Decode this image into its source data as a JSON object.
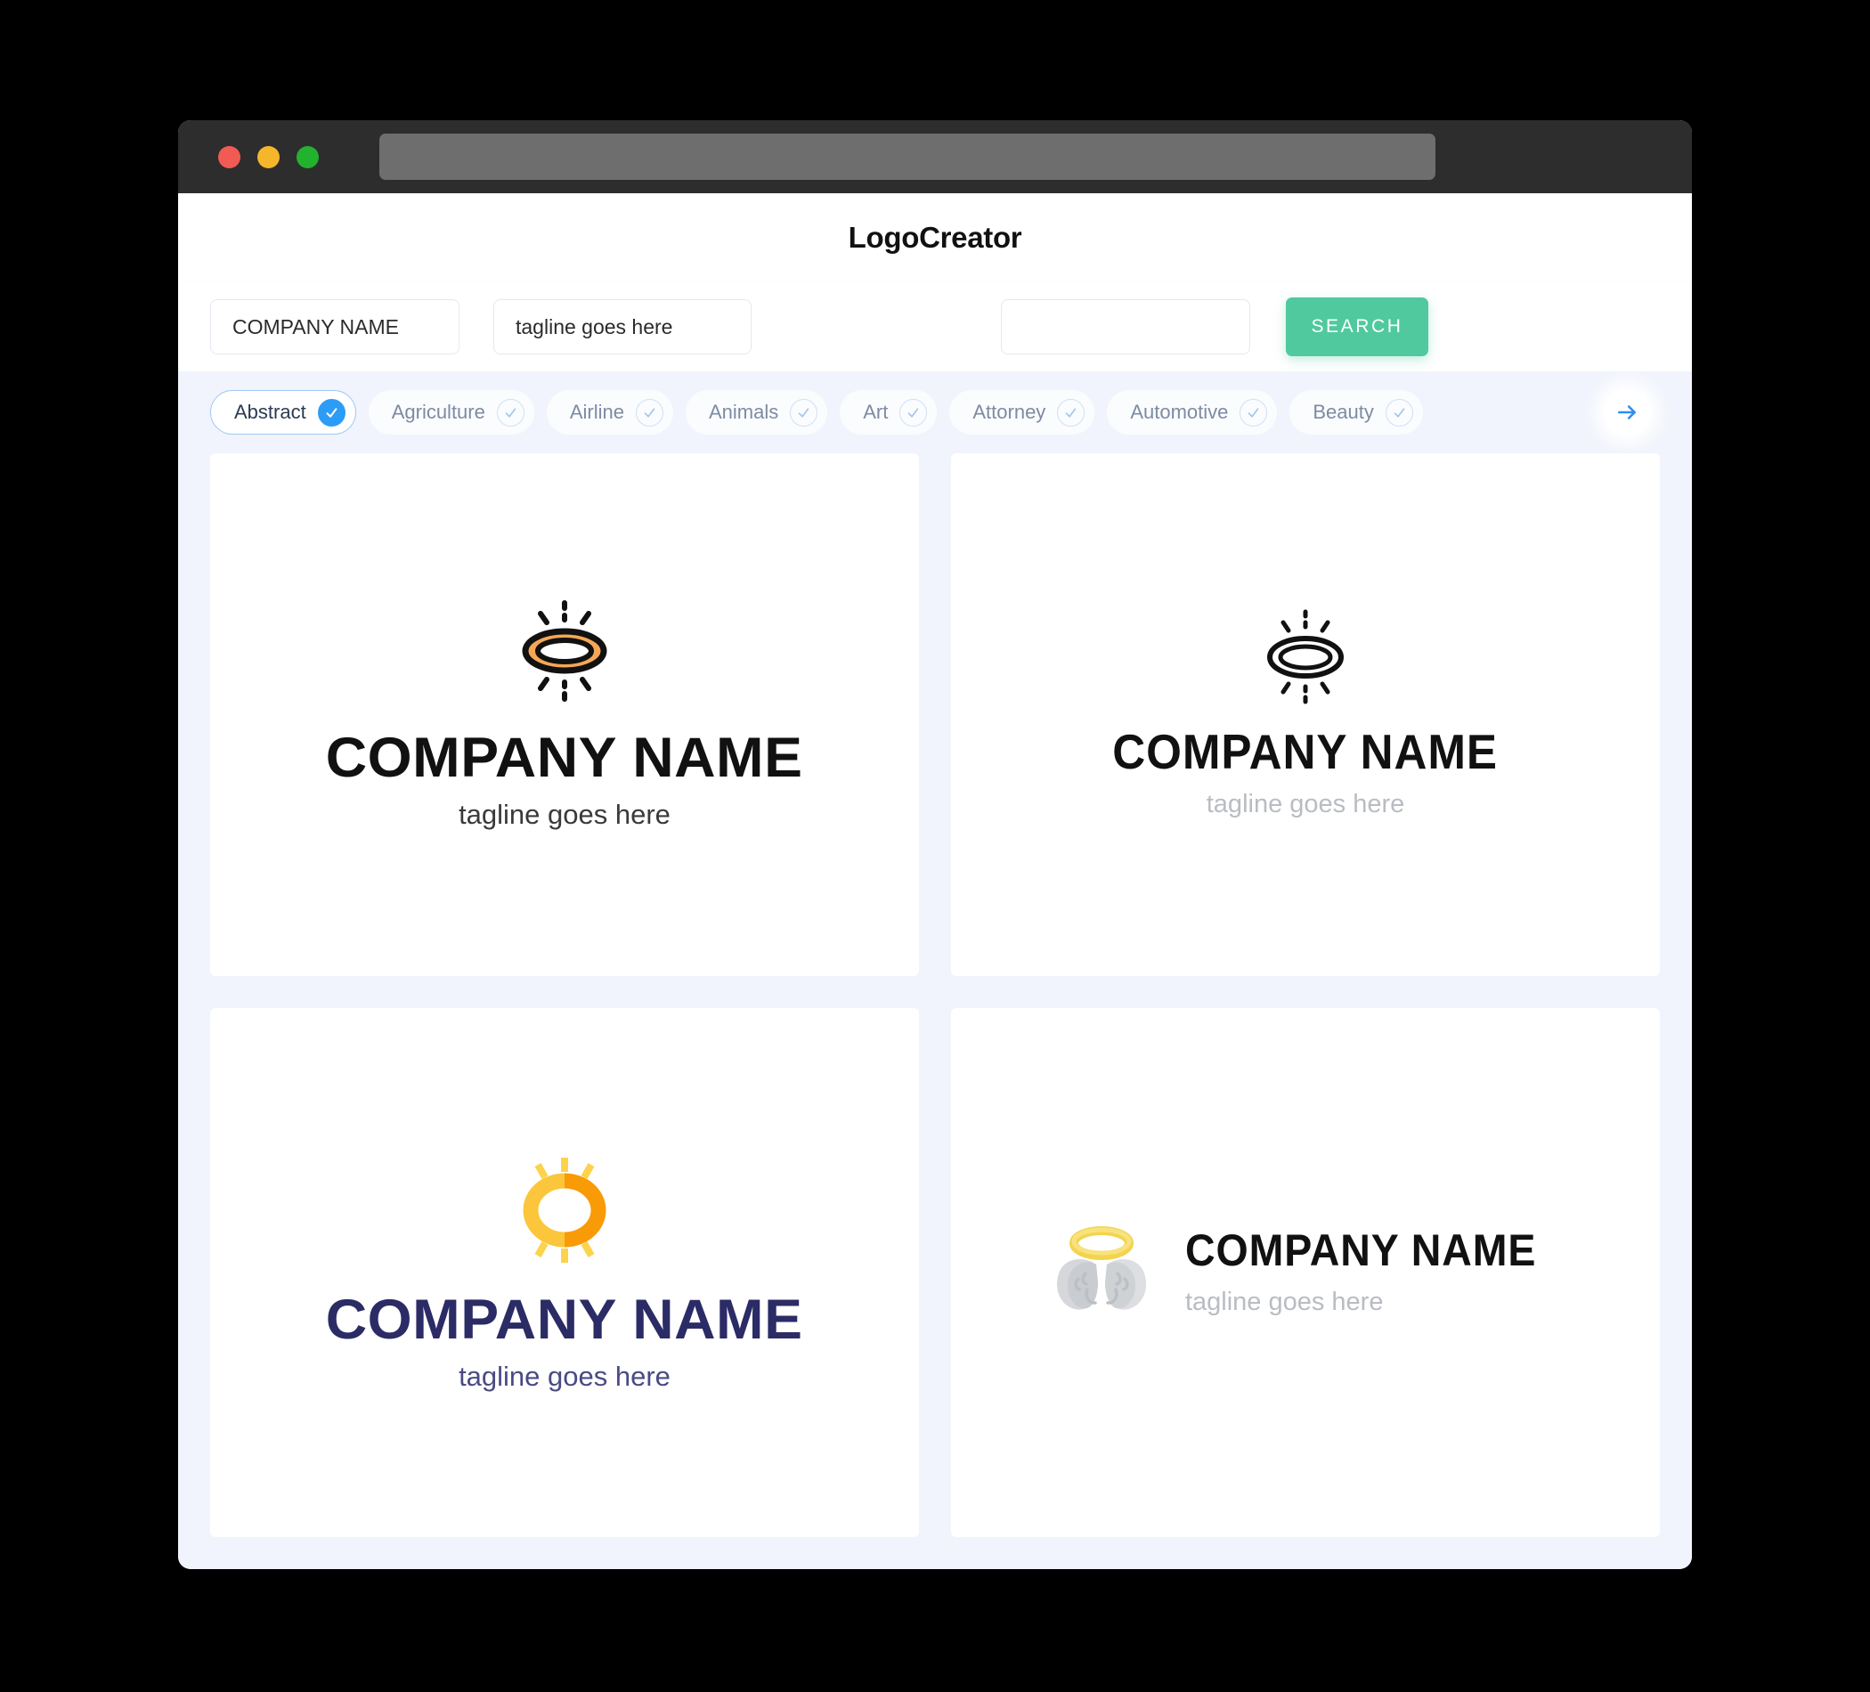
{
  "window": {
    "traffic_lights": [
      {
        "name": "close",
        "color": "#f25b54"
      },
      {
        "name": "minimize",
        "color": "#f5b62b"
      },
      {
        "name": "maximize",
        "color": "#22b22e"
      }
    ],
    "url_value": ""
  },
  "header": {
    "app_title": "LogoCreator"
  },
  "search": {
    "company_value": "COMPANY NAME",
    "company_placeholder": "COMPANY NAME",
    "tagline_value": "tagline goes here",
    "tagline_placeholder": "tagline goes here",
    "extra_value": "",
    "extra_placeholder": "",
    "search_label": "SEARCH",
    "search_button_color": "#50c99f"
  },
  "categories": {
    "next_icon": "arrow-right-icon",
    "items": [
      {
        "label": "Abstract",
        "selected": true
      },
      {
        "label": "Agriculture",
        "selected": false
      },
      {
        "label": "Airline",
        "selected": false
      },
      {
        "label": "Animals",
        "selected": false
      },
      {
        "label": "Art",
        "selected": false
      },
      {
        "label": "Attorney",
        "selected": false
      },
      {
        "label": "Automotive",
        "selected": false
      },
      {
        "label": "Beauty",
        "selected": false
      }
    ],
    "active_color": "#2d9cf7"
  },
  "results": [
    {
      "id": "logo-1",
      "icon": "halo-burst-icon",
      "layout": "stacked",
      "name": "COMPANY NAME",
      "tagline": "tagline goes here",
      "name_color": "#111111",
      "tagline_color": "#3a3a3a",
      "mark_colors": {
        "fill": "#f5a755",
        "stroke": "#111111"
      }
    },
    {
      "id": "logo-2",
      "icon": "halo-burst-outline-icon",
      "layout": "stacked",
      "name": "COMPANY NAME",
      "tagline": "tagline goes here",
      "name_color": "#111111",
      "tagline_color": "#b9bcc2",
      "mark_colors": {
        "fill": "none",
        "stroke": "#111111"
      }
    },
    {
      "id": "logo-3",
      "icon": "sun-ring-icon",
      "layout": "stacked",
      "name": "COMPANY NAME",
      "tagline": "tagline goes here",
      "name_color": "#2b2b66",
      "tagline_color": "#4a4a85",
      "mark_colors": {
        "light": "#fbc63c",
        "dark": "#f99a07",
        "rays": "#fcd34a"
      }
    },
    {
      "id": "logo-4",
      "icon": "angel-wings-halo-icon",
      "layout": "horizontal",
      "name": "COMPANY NAME",
      "tagline": "tagline goes here",
      "name_color": "#111111",
      "tagline_color": "#b9bcc2",
      "mark_colors": {
        "halo": "#f3d44e",
        "halo_light": "#f8e27f",
        "wing": "#d5d7da",
        "wing_dark": "#c3c6ca"
      }
    }
  ]
}
